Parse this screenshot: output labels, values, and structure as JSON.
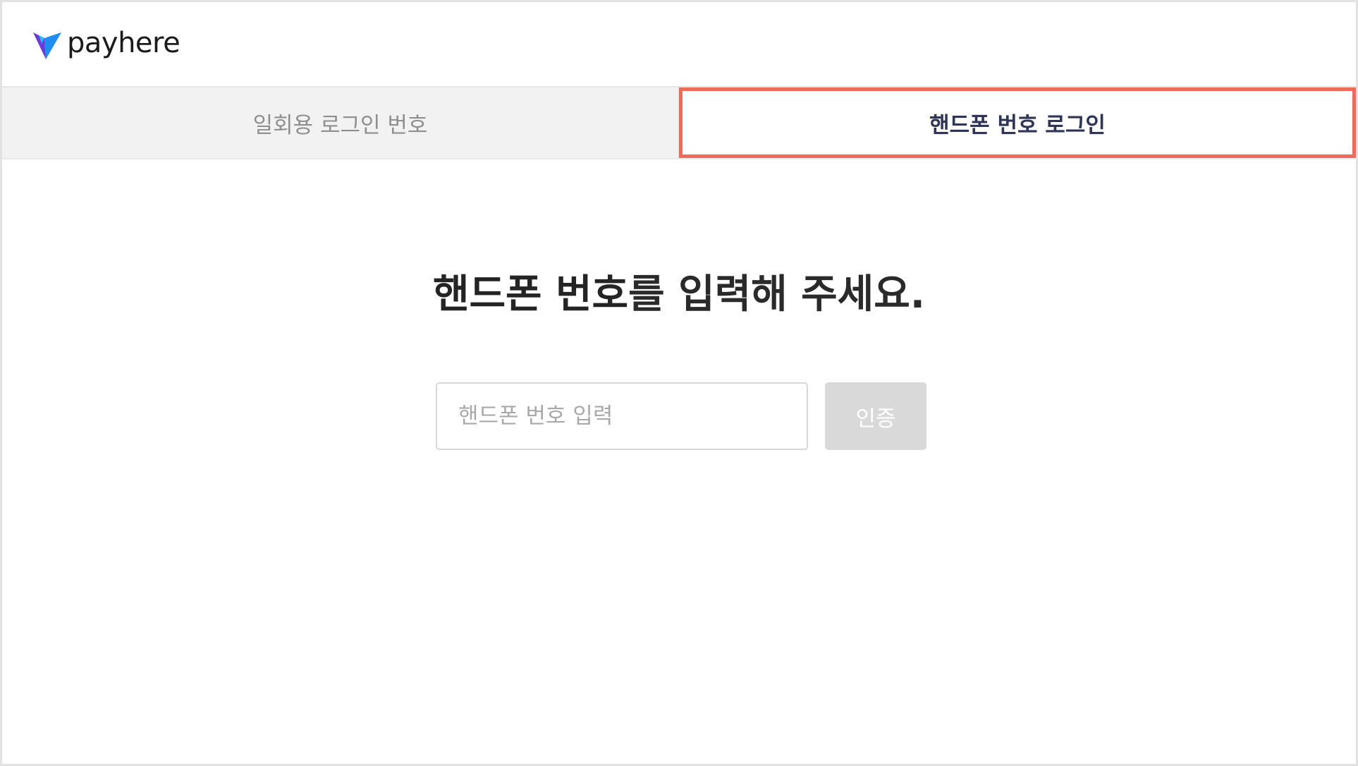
{
  "brand": {
    "name": "payhere",
    "logo_colors": [
      "#1e8cf0",
      "#6a3bd6",
      "#2fb6f5"
    ]
  },
  "tabs": [
    {
      "label": "일회용 로그인 번호",
      "active": false
    },
    {
      "label": "핸드폰 번호 로그인",
      "active": true
    }
  ],
  "prompt": {
    "bold": "핸드폰 번호",
    "rest": "를 입력해 주세요."
  },
  "phone_field": {
    "value": "",
    "placeholder": "핸드폰 번호 입력"
  },
  "auth_button": {
    "label": "인증",
    "enabled": false
  },
  "colors": {
    "active_tab_border": "#ee6b5c",
    "active_tab_text": "#2e3556",
    "inactive_tab_bg": "#f2f2f2",
    "button_disabled_bg": "#d9d9d9"
  }
}
